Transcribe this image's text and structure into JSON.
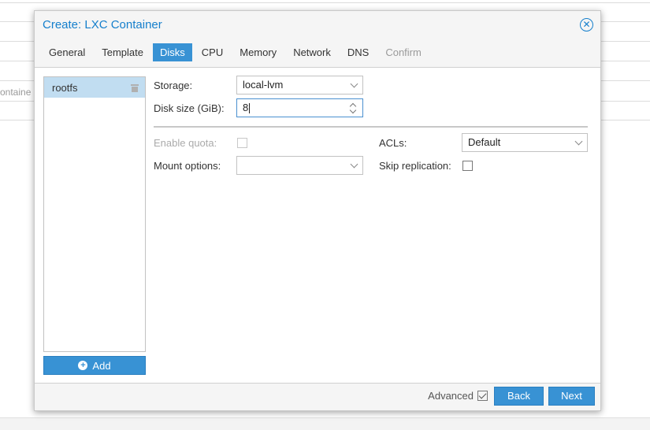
{
  "background": {
    "fragment_text": "ontaine"
  },
  "dialog": {
    "title": "Create: LXC Container",
    "tabs": [
      {
        "label": "General",
        "state": "normal"
      },
      {
        "label": "Template",
        "state": "normal"
      },
      {
        "label": "Disks",
        "state": "active"
      },
      {
        "label": "CPU",
        "state": "normal"
      },
      {
        "label": "Memory",
        "state": "normal"
      },
      {
        "label": "Network",
        "state": "normal"
      },
      {
        "label": "DNS",
        "state": "normal"
      },
      {
        "label": "Confirm",
        "state": "disabled"
      }
    ],
    "disks": [
      {
        "label": "rootfs",
        "selected": true
      }
    ],
    "add_label": "Add",
    "form": {
      "storage": {
        "label": "Storage:",
        "value": "local-lvm"
      },
      "disk_size": {
        "label": "Disk size (GiB):",
        "value": "8"
      },
      "enable_quota": {
        "label": "Enable quota:",
        "checked": false,
        "disabled": true
      },
      "acls": {
        "label": "ACLs:",
        "value": "Default"
      },
      "mount_options": {
        "label": "Mount options:",
        "value": ""
      },
      "skip_replication": {
        "label": "Skip replication:",
        "checked": false
      }
    },
    "footer": {
      "advanced_label": "Advanced",
      "advanced_checked": true,
      "back_label": "Back",
      "next_label": "Next"
    }
  },
  "colors": {
    "accent": "#3892d4",
    "title": "#157fcc",
    "selected_row": "#c1ddf1"
  }
}
